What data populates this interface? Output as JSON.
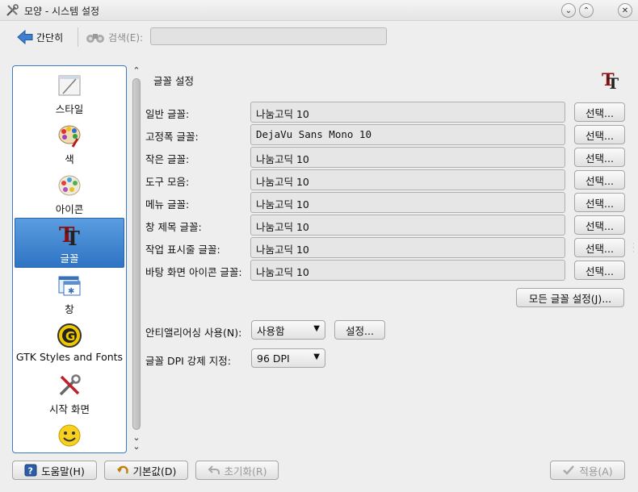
{
  "window": {
    "title": "모양 - 시스템 설정",
    "buttons": [
      "minimize-icon",
      "maximize-icon",
      "close-icon"
    ]
  },
  "toolbar": {
    "back_label": "간단히",
    "search_label": "검색(E):",
    "search_value": ""
  },
  "sidebar": {
    "items": [
      {
        "label": "스타일",
        "icon": "style-icon"
      },
      {
        "label": "색",
        "icon": "color-palette-icon"
      },
      {
        "label": "아이콘",
        "icon": "icons-icon"
      },
      {
        "label": "글꼴",
        "icon": "fonts-icon",
        "active": true
      },
      {
        "label": "창",
        "icon": "window-icon"
      },
      {
        "label": "GTK Styles and Fonts",
        "icon": "gtk-icon"
      },
      {
        "label": "시작 화면",
        "icon": "splash-tools-icon"
      },
      {
        "label": "",
        "icon": "emoticon-icon"
      }
    ]
  },
  "main": {
    "title": "글꼴 설정",
    "choose_label": "선택...",
    "fonts": [
      {
        "label": "일반 글꼴:",
        "value": "나눔고딕 10"
      },
      {
        "label": "고정폭 글꼴:",
        "value": "DejaVu Sans Mono 10"
      },
      {
        "label": "작은 글꼴:",
        "value": "나눔고딕 10"
      },
      {
        "label": "도구 모음:",
        "value": "나눔고딕 10"
      },
      {
        "label": "메뉴 글꼴:",
        "value": "나눔고딕 10"
      },
      {
        "label": "창 제목 글꼴:",
        "value": "나눔고딕 10"
      },
      {
        "label": "작업 표시줄 글꼴:",
        "value": "나눔고딕 10"
      },
      {
        "label": "바탕 화면 아이콘 글꼴:",
        "value": "나눔고딕 10"
      }
    ],
    "all_fonts_button": "모든 글꼴 설정(J)...",
    "antialias_label": "안티앨리어싱 사용(N):",
    "antialias_value": "사용함",
    "antialias_settings": "설정...",
    "dpi_label": "글꼴 DPI 강제 지정:",
    "dpi_value": "96 DPI"
  },
  "footer": {
    "help": "도움말(H)",
    "defaults": "기본값(D)",
    "reset": "초기화(R)",
    "apply": "적용(A)"
  }
}
